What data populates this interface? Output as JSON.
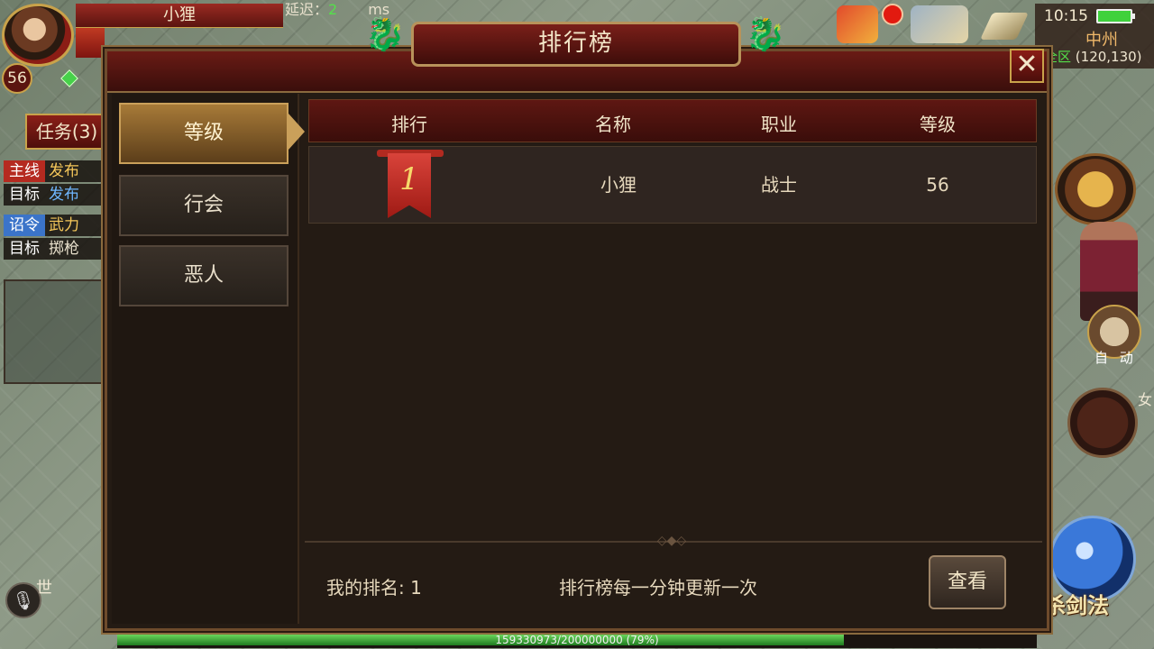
{
  "player": {
    "name": "小狸",
    "level": "56",
    "latency_label": "延迟：",
    "latency_value": "2",
    "latency_unit": "ms"
  },
  "quests": {
    "tab_label": "任务(3)",
    "rows": [
      {
        "tag": "主线",
        "text": "发布"
      },
      {
        "tag": "目标",
        "text": "发布"
      },
      {
        "tag": "诏令",
        "text": "武力"
      },
      {
        "tag": "目标",
        "text": "掷枪"
      }
    ]
  },
  "hud": {
    "clock": "10:15",
    "map_name": "中州",
    "zone": "全区",
    "coords": "(120,130)",
    "world_chat_label": "世",
    "auto_label": "自 动",
    "skill_name": "杀剑法",
    "side_label": "女",
    "exp_text": "159330973/200000000 (79%)",
    "exp_progress": 0.79
  },
  "dialog": {
    "title": "排行榜",
    "close_glyph": "✕",
    "categories": [
      {
        "label": "等级",
        "active": true
      },
      {
        "label": "行会",
        "active": false
      },
      {
        "label": "恶人",
        "active": false
      }
    ],
    "columns": [
      "排行",
      "名称",
      "职业",
      "等级"
    ],
    "rows": [
      {
        "rank": "1",
        "name": "小狸",
        "class": "战士",
        "level": "56"
      }
    ],
    "my_rank": "我的排名: 1",
    "update_note": "排行榜每一分钟更新一次",
    "view_button": "查看"
  },
  "colors": {
    "accent_gold": "#caa05a",
    "header_red": "#5e1712",
    "exp_green": "#3fb83a"
  }
}
